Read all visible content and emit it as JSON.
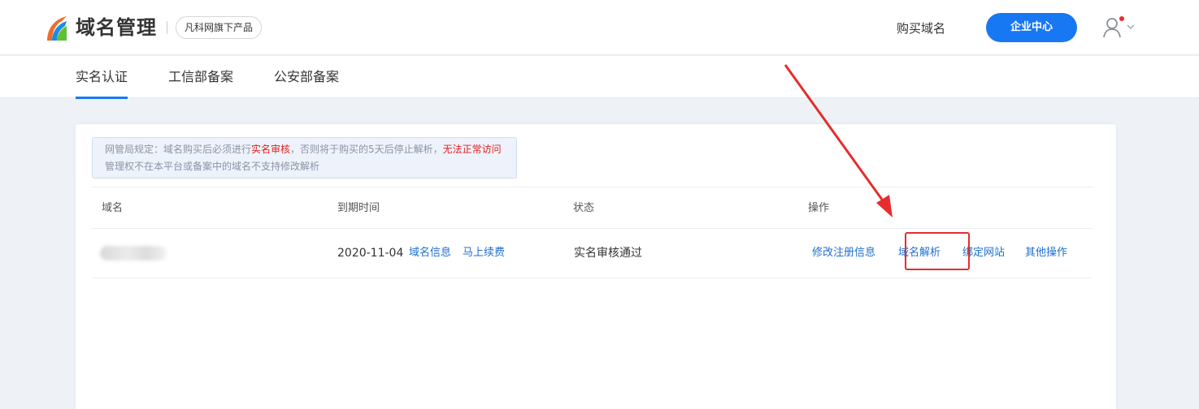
{
  "header": {
    "logo_text": "域名管理",
    "logo_badge": "凡科网旗下产品",
    "buy_domain": "购买域名",
    "enterprise_center": "企业中心",
    "colors": {
      "primary": "#1877f2",
      "notify_dot": "#e52d2d"
    }
  },
  "tabs": [
    {
      "label": "实名认证",
      "active": true
    },
    {
      "label": "工信部备案",
      "active": false
    },
    {
      "label": "公安部备案",
      "active": false
    }
  ],
  "notice": {
    "line1_part1": "网管局规定：域名购买后必须进行",
    "line1_red1": "实名审核",
    "line1_part2": "，否则将于购买的5天后停止解析，",
    "line1_red2": "无法正常访问",
    "line2": "管理权不在本平台或备案中的域名不支持修改解析"
  },
  "table": {
    "columns": [
      "域名",
      "到期时间",
      "状态",
      "操作"
    ],
    "rows": [
      {
        "expiry": "2020-11-04",
        "expiry_links": [
          "域名信息",
          "马上续费"
        ],
        "status": "实名审核通过",
        "actions": [
          "修改注册信息",
          "域名解析",
          "绑定网站",
          "其他操作"
        ]
      }
    ]
  }
}
